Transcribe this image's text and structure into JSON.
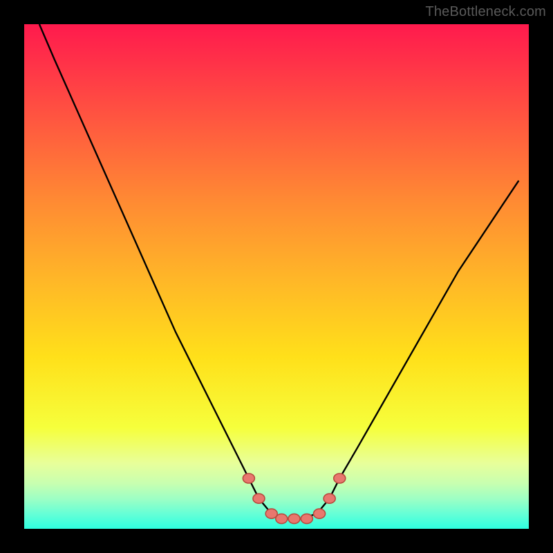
{
  "watermark": "TheBottleneck.com",
  "chart_data": {
    "type": "line",
    "title": "",
    "xlabel": "",
    "ylabel": "",
    "xlim": [
      0,
      1
    ],
    "ylim": [
      0,
      1
    ],
    "series": [
      {
        "name": "curve",
        "x": [
          0.03,
          0.06,
          0.1,
          0.14,
          0.18,
          0.22,
          0.26,
          0.3,
          0.34,
          0.38,
          0.42,
          0.445,
          0.465,
          0.49,
          0.52,
          0.55,
          0.58,
          0.605,
          0.625,
          0.66,
          0.7,
          0.74,
          0.78,
          0.82,
          0.86,
          0.9,
          0.94,
          0.98
        ],
        "y": [
          1.0,
          0.93,
          0.84,
          0.75,
          0.66,
          0.57,
          0.48,
          0.39,
          0.31,
          0.23,
          0.15,
          0.1,
          0.06,
          0.03,
          0.02,
          0.02,
          0.03,
          0.06,
          0.1,
          0.16,
          0.23,
          0.3,
          0.37,
          0.44,
          0.51,
          0.57,
          0.63,
          0.69
        ]
      }
    ],
    "markers": {
      "x": [
        0.445,
        0.465,
        0.49,
        0.51,
        0.535,
        0.56,
        0.585,
        0.605,
        0.625
      ],
      "y": [
        0.1,
        0.06,
        0.03,
        0.02,
        0.02,
        0.02,
        0.03,
        0.06,
        0.1
      ]
    }
  }
}
